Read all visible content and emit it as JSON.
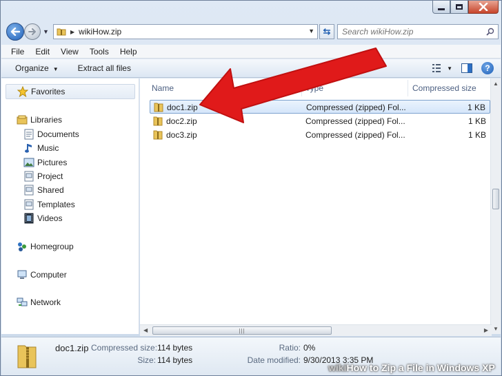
{
  "window": {
    "title": "wikiHow.zip"
  },
  "address": {
    "path": "wikiHow.zip"
  },
  "search": {
    "placeholder": "Search wikiHow.zip"
  },
  "menu": [
    "File",
    "Edit",
    "View",
    "Tools",
    "Help"
  ],
  "commands": {
    "organize": "Organize",
    "extract_all": "Extract all files"
  },
  "nav": {
    "favorites": "Favorites",
    "libraries": "Libraries",
    "library_items": [
      "Documents",
      "Music",
      "Pictures",
      "Project",
      "Shared",
      "Templates",
      "Videos"
    ],
    "homegroup": "Homegroup",
    "computer": "Computer",
    "network": "Network"
  },
  "columns": {
    "name": "Name",
    "type": "Type",
    "size": "Compressed size"
  },
  "files": [
    {
      "name": "doc1.zip",
      "type": "Compressed (zipped) Fol...",
      "size": "1 KB"
    },
    {
      "name": "doc2.zip",
      "type": "Compressed (zipped) Fol...",
      "size": "1 KB"
    },
    {
      "name": "doc3.zip",
      "type": "Compressed (zipped) Fol...",
      "size": "1 KB"
    }
  ],
  "details": {
    "name": "doc1.zip",
    "compressed_size_label": "Compressed size:",
    "compressed_size": "114 bytes",
    "size_label": "Size:",
    "size": "114 bytes",
    "ratio_label": "Ratio:",
    "ratio": "0%",
    "date_label": "Date modified:",
    "date": "9/30/2013 3:35 PM"
  },
  "watermark": {
    "brand": "wiki",
    "text": "How to Zip a File in Windows XP"
  },
  "colors": {
    "arrow": "#e01a1a",
    "selection_border": "#7da2ce",
    "accent": "#1d5fb8"
  }
}
